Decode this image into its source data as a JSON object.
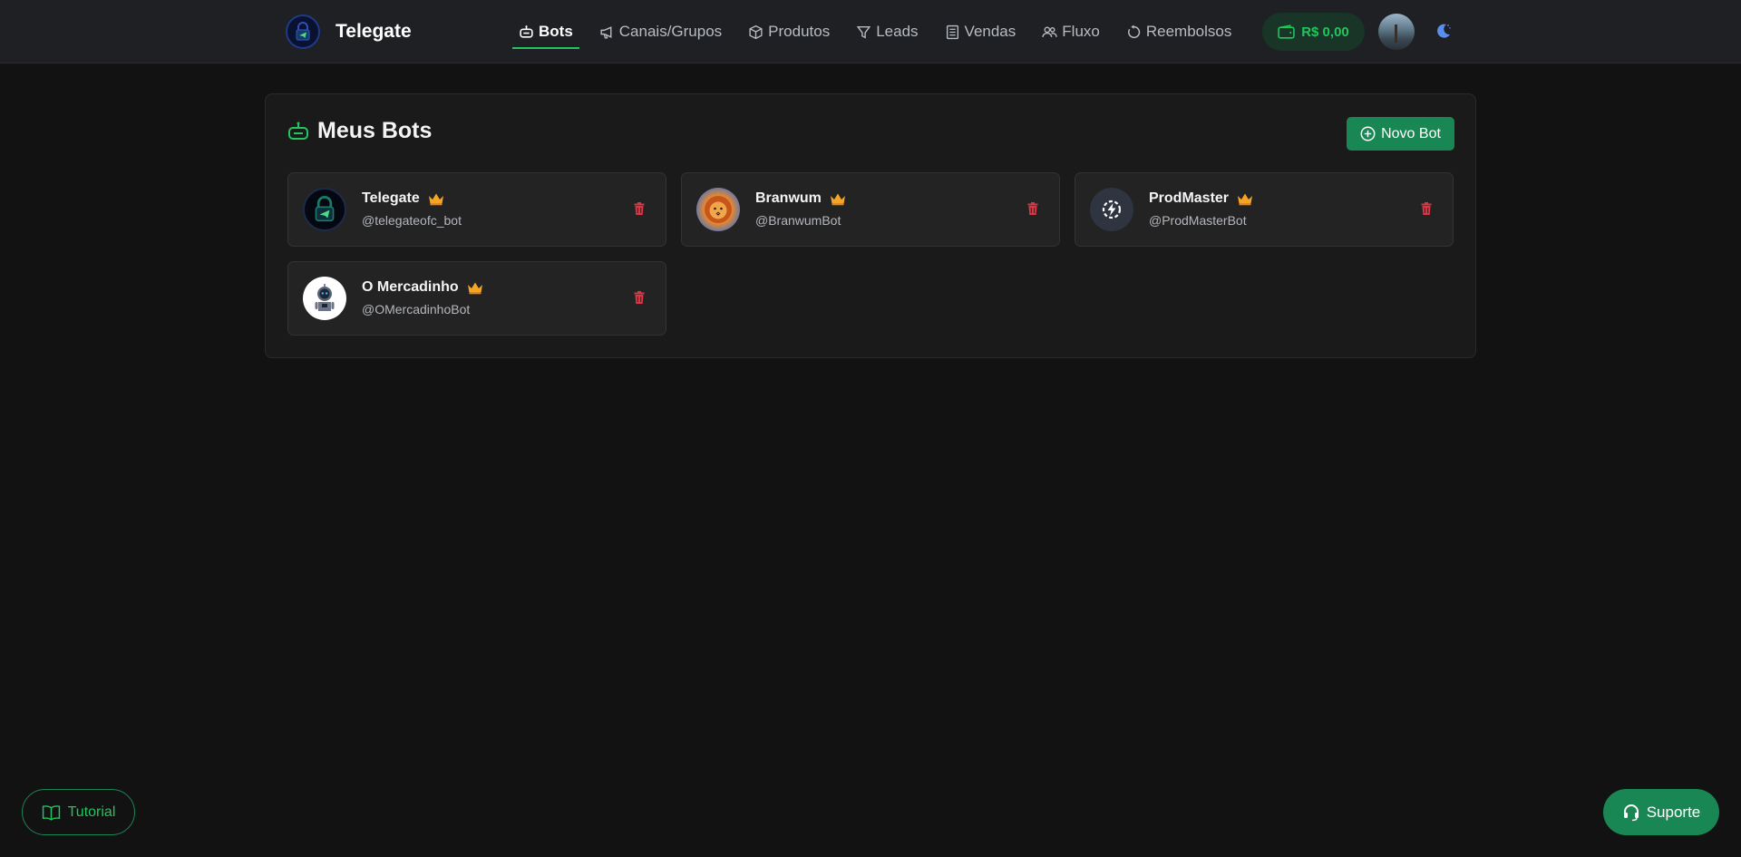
{
  "brand": {
    "name": "Telegate",
    "logo_icon": "lock-telegram-logo"
  },
  "nav": {
    "items": [
      {
        "label": "Bots",
        "icon": "robot-icon",
        "active": true
      },
      {
        "label": "Canais/Grupos",
        "icon": "megaphone-icon"
      },
      {
        "label": "Produtos",
        "icon": "box-icon"
      },
      {
        "label": "Leads",
        "icon": "filter-icon"
      },
      {
        "label": "Vendas",
        "icon": "receipt-icon"
      },
      {
        "label": "Fluxo",
        "icon": "users-icon"
      },
      {
        "label": "Reembolsos",
        "icon": "refresh-icon"
      }
    ]
  },
  "balance": {
    "label": "R$ 0,00",
    "icon": "wallet-icon",
    "color": "#22c55e"
  },
  "theme_toggle": {
    "icon": "moon-icon"
  },
  "panel": {
    "title": "Meus Bots",
    "title_icon": "robot-icon",
    "new_bot_label": "Novo Bot",
    "bots": [
      {
        "name": "Telegate",
        "handle": "@telegateofc_bot",
        "avatar": "telegate-logo",
        "premium": true
      },
      {
        "name": "Branwum",
        "handle": "@BranwumBot",
        "avatar": "lion-avatar",
        "premium": true
      },
      {
        "name": "ProdMaster",
        "handle": "@ProdMasterBot",
        "avatar": "lightning-gear-avatar",
        "premium": true
      },
      {
        "name": "O Mercadinho",
        "handle": "@OMercadinhoBot",
        "avatar": "robot-avatar",
        "premium": true
      }
    ]
  },
  "tutorial": {
    "label": "Tutorial",
    "icon": "book-icon"
  },
  "support": {
    "label": "Suporte",
    "icon": "headset-icon"
  },
  "colors": {
    "accent": "#198754",
    "accent_text": "#22c55e",
    "danger": "#dc3545",
    "crown": "#f5a524",
    "background": "#121212"
  }
}
